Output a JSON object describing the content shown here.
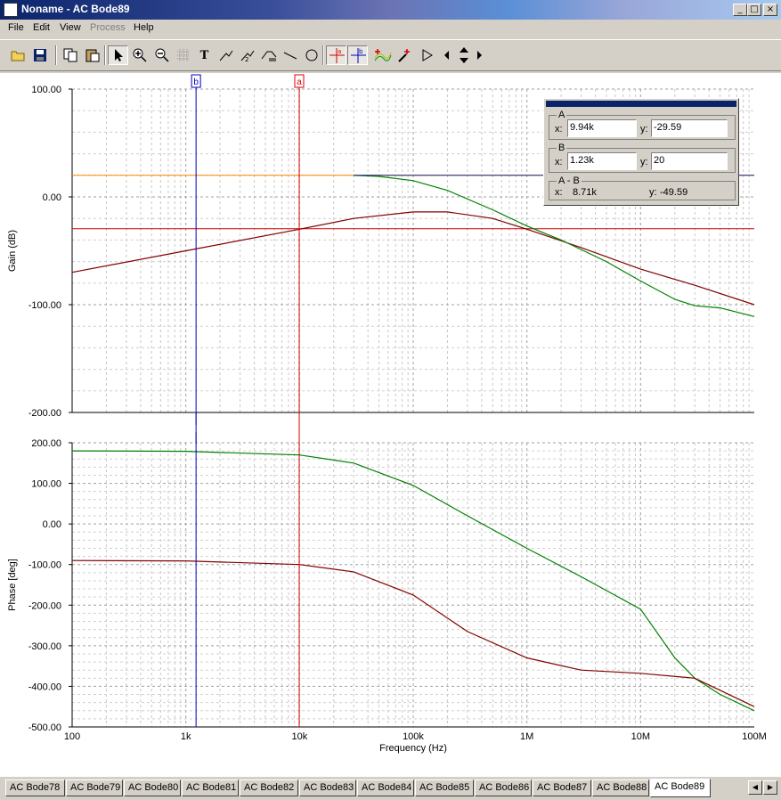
{
  "window": {
    "title": "Noname - AC Bode89",
    "min": "_",
    "max": "□",
    "close": "×"
  },
  "menu": {
    "file": "File",
    "edit": "Edit",
    "view": "View",
    "process": "Process",
    "help": "Help"
  },
  "toolbar_icons": [
    "open-icon",
    "save-icon",
    "copy-icon",
    "paste-icon",
    "pointer-icon",
    "zoom-in-icon",
    "zoom-out-icon",
    "grid-icon",
    "text-icon",
    "label-icon",
    "label2-icon",
    "axis-label-icon",
    "line-icon",
    "circle-icon",
    "cursor-a-icon",
    "cursor-b-icon",
    "add-curve-icon",
    "probe-icon",
    "play-icon",
    "nav-left-icon",
    "nav-updown-icon",
    "nav-right-icon"
  ],
  "cursor_box": {
    "a": {
      "group": "A",
      "x_label": "x:",
      "x": "9.94k",
      "y_label": "y:",
      "y": "-29.59"
    },
    "b": {
      "group": "B",
      "x_label": "x:",
      "x": "1.23k",
      "y_label": "y:",
      "y": "20"
    },
    "ab": {
      "group": "A - B",
      "x_label": "x:",
      "x": "8.71k",
      "y_label": "y:",
      "y": "-49.59"
    }
  },
  "cursor_tags": {
    "a": "a",
    "b": "b"
  },
  "chart_data": [
    {
      "type": "line",
      "title": "",
      "xlabel": "",
      "ylabel": "Gain (dB)",
      "x_scale": "log",
      "xlim": [
        100,
        100000000
      ],
      "ylim": [
        -200,
        100
      ],
      "y_ticks": [
        "100.00",
        "0.00",
        "-100.00",
        "-200.00"
      ],
      "grid": true,
      "series": [
        {
          "color": "#800000",
          "x": [
            100,
            1000,
            10000,
            30000,
            100000,
            200000,
            500000,
            1000000,
            3000000,
            10000000,
            30000000,
            100000000
          ],
          "y": [
            -70,
            -50,
            -30,
            -20,
            -14,
            -14,
            -20,
            -30,
            -47,
            -67,
            -82,
            -100
          ]
        },
        {
          "color": "#008000",
          "x": [
            30000,
            50000,
            100000,
            200000,
            500000,
            1000000,
            2000000,
            5000000,
            10000000,
            20000000,
            30000000,
            50000000,
            100000000
          ],
          "y": [
            20,
            19,
            15,
            6,
            -12,
            -27,
            -40,
            -60,
            -78,
            -95,
            -101,
            -103,
            -111
          ]
        }
      ],
      "markers": [
        {
          "name": "cursor-a-gain-level",
          "y": -29.59,
          "color": "#d00000"
        },
        {
          "name": "cursor-b-gain-level",
          "y": 20,
          "color": "#ff8000"
        }
      ]
    },
    {
      "type": "line",
      "title": "",
      "xlabel": "Frequency (Hz)",
      "ylabel": "Phase [deg]",
      "x_scale": "log",
      "xlim": [
        100,
        100000000
      ],
      "ylim": [
        -500,
        200
      ],
      "x_ticks": [
        "100",
        "1k",
        "10k",
        "100k",
        "1M",
        "10M",
        "100M"
      ],
      "y_ticks": [
        "200.00",
        "100.00",
        "0.00",
        "-100.00",
        "-200.00",
        "-300.00",
        "-400.00",
        "-500.00"
      ],
      "grid": true,
      "series": [
        {
          "color": "#008000",
          "x": [
            100,
            1000,
            10000,
            30000,
            100000,
            300000,
            1000000,
            3000000,
            10000000,
            20000000,
            30000000,
            50000000,
            100000000
          ],
          "y": [
            180,
            179,
            170,
            150,
            95,
            20,
            -60,
            -130,
            -210,
            -330,
            -380,
            -420,
            -460
          ]
        },
        {
          "color": "#800000",
          "x": [
            100,
            1000,
            10000,
            30000,
            100000,
            300000,
            1000000,
            3000000,
            10000000,
            30000000,
            100000000
          ],
          "y": [
            -90,
            -91,
            -100,
            -118,
            -175,
            -265,
            -330,
            -360,
            -368,
            -380,
            -450
          ]
        }
      ]
    }
  ],
  "cursors": {
    "a_freq": 9940,
    "b_freq": 1230
  },
  "tabs": [
    "AC Bode78",
    "AC Bode79",
    "AC Bode80",
    "AC Bode81",
    "AC Bode82",
    "AC Bode83",
    "AC Bode84",
    "AC Bode85",
    "AC Bode86",
    "AC Bode87",
    "AC Bode88",
    "AC Bode89"
  ],
  "active_tab": "AC Bode89"
}
